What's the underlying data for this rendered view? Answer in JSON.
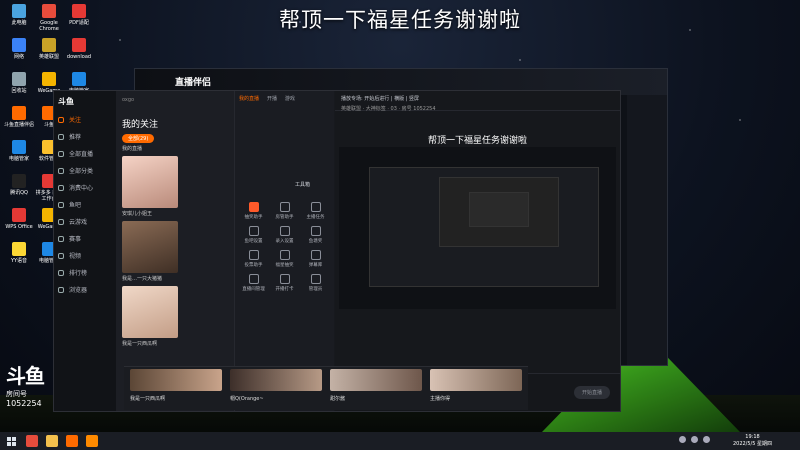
{
  "overlay_title": "帮顶一下福星任务谢谢啦",
  "desktop_icons": [
    {
      "label": "此电脑",
      "color": "#4aa3df"
    },
    {
      "label": "Google Chrome",
      "color": "#e74c3c"
    },
    {
      "label": "PDF适配",
      "color": "#e53935"
    },
    {
      "label": "网络",
      "color": "#3b82f6"
    },
    {
      "label": "英雄联盟",
      "color": "#c9a227"
    },
    {
      "label": "download",
      "color": "#e53935"
    },
    {
      "label": "回收站",
      "color": "#90a4ae"
    },
    {
      "label": "WeGame",
      "color": "#f4b400"
    },
    {
      "label": "电脑管家",
      "color": "#1e88e5"
    },
    {
      "label": "斗鱼直播伴侣",
      "color": "#ff6a00"
    },
    {
      "label": "斗鱼",
      "color": "#ff6a00"
    },
    {
      "label": "新媒体工作室",
      "color": "#43a047"
    },
    {
      "label": "电脑管家",
      "color": "#1e88e5"
    },
    {
      "label": "软件管家",
      "color": "#fbc02d"
    },
    {
      "label": "拼多多",
      "color": "#e53935"
    },
    {
      "label": "腾讯QQ",
      "color": "#222"
    },
    {
      "label": "拼多多 商家工作台",
      "color": "#e53935"
    },
    {
      "label": "鼠大侠",
      "color": "#26a69a"
    },
    {
      "label": "WPS Office",
      "color": "#e53935"
    },
    {
      "label": "WeGame",
      "color": "#f4b400"
    },
    {
      "label": "VLC media player",
      "color": "#ff8f00"
    },
    {
      "label": "YY语音",
      "color": "#fdd835"
    },
    {
      "label": "电脑管家",
      "color": "#1e88e5"
    }
  ],
  "bg_window": {
    "logo": "直播伴侣"
  },
  "main_window": {
    "brand": "斗鱼",
    "search": "oxgo",
    "nav": [
      "关注",
      "推荐",
      "全部直播",
      "全部分类",
      "消费中心",
      "鱼吧",
      "云游戏",
      "赛事",
      "视频",
      "排行榜",
      "浏览器"
    ],
    "follow_title": "我的关注",
    "follow_pill": "全部(29)",
    "follow_sub": "我的直播",
    "streamers": [
      "安琪儿小姐王",
      "我是…一只大猪猪",
      "我是一只西瓜啊"
    ],
    "tools_tabs": [
      "我的直播",
      "开播",
      "游戏"
    ],
    "tools_label": "工具箱",
    "tools": [
      "抽奖助手",
      "房管助手",
      "主播任务",
      "鱼吧设置",
      "录入设置",
      "鱼塘奖",
      "投票助手",
      "福星抽奖",
      "弹幕库",
      "直播间管理",
      "开播打卡",
      "管理员"
    ],
    "stage_head": "播放专场: 开始后进行 | 横版 | 竖屏",
    "stage_sub": "英雄联盟 · 大神标签 · 03 · 房号 1052254",
    "stage_title": "帮顶一下福星任务谢谢啦",
    "stage_buttons": [
      "直播屏幕",
      "摄像头",
      "手机投屏",
      "多媒体",
      "麦克风",
      "扬声器"
    ],
    "start_label": "开始直播",
    "bottom_names": [
      "我是一只西瓜啊",
      "帽Q(Orange~",
      "甜尔酱",
      "主播你得"
    ]
  },
  "watermark": {
    "logo": "斗鱼",
    "label": "房间号",
    "room": "1052254"
  },
  "taskbar": {
    "time": "19:18",
    "date": "2022/5/5 星期四"
  }
}
